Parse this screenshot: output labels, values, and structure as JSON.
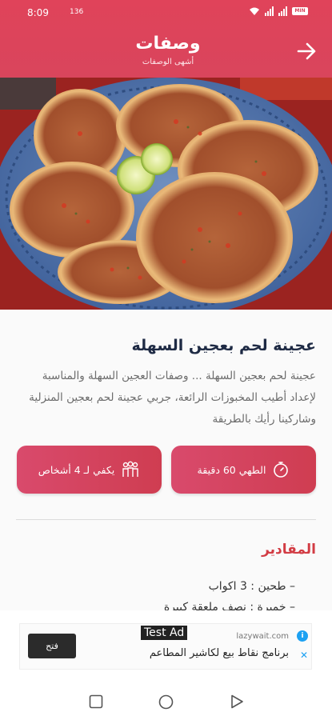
{
  "status_bar": {
    "time": "8:09",
    "network": "136",
    "battery": "MIN"
  },
  "header": {
    "title": "وصفات",
    "subtitle": "أشهى الوصفات",
    "back_icon": "arrow-right-icon"
  },
  "hero": {
    "image": "lahm-bi-ajeen-plate"
  },
  "recipe": {
    "title": "عجينة لحم بعجين السهلة",
    "description": "عجينة لحم بعجين السهلة ... وصفات العجين السهلة والمناسبة لإعداد أطيب المخبوزات الرائعة، جربي عجينة لحم بعجين المنزلية وشاركينا رأيك بالطريقة",
    "cook_time": "الطهي 60 دقيقة",
    "serves": "يكفي لـ 4 أشخاص",
    "cook_icon": "stopwatch-icon",
    "serves_icon": "people-icon"
  },
  "ingredients": {
    "title": "المقادير",
    "items": [
      "– طحين : 3 اكواب",
      "– خميرة : نصف ملعقة كبيرة"
    ]
  },
  "ad": {
    "label": "Test Ad",
    "domain": "lazywait.com",
    "text": "برنامج نقاط بيع لكاشير المطاعم",
    "open_button": "فتح"
  },
  "colors": {
    "primary": "#d9455c",
    "title": "#1e2a44",
    "section": "#d23c44"
  }
}
